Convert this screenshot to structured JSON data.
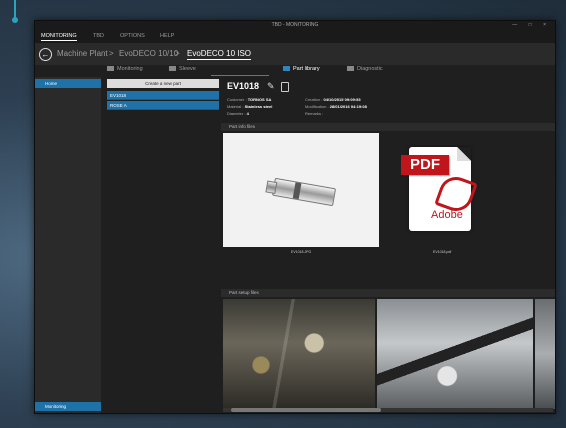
{
  "window": {
    "title": "TBD - MONITORING",
    "controls": "—  □  ×"
  },
  "menu": {
    "items": [
      "MONITORING",
      "TBD",
      "OPTIONS",
      "HELP"
    ]
  },
  "breadcrumb": {
    "back_icon": "back-arrow-icon",
    "items": [
      "Machine Plant",
      "EvoDECO 10/10",
      "EvoDECO 10 ISO"
    ],
    "separator": ">"
  },
  "tabs": [
    {
      "label": "Monitoring",
      "icon": "monitor-icon"
    },
    {
      "label": "Sleeve",
      "icon": "sleeve-icon"
    },
    {
      "label": "Part library",
      "icon": "library-icon",
      "active": true
    },
    {
      "label": "Diagnostic",
      "icon": "diagnostic-icon"
    }
  ],
  "sidebar": {
    "items": [
      "Home"
    ],
    "bottom": "Monitoring"
  },
  "parts": {
    "new_label": "Create a new part",
    "list": [
      "EV1018",
      "ROSE A"
    ]
  },
  "detail": {
    "name": "EV1018",
    "fields_left": [
      {
        "label": "Customer",
        "value": "TORNOS SA"
      },
      {
        "label": "Material",
        "value": "Stainless steel"
      },
      {
        "label": "Diameter",
        "value": "4"
      }
    ],
    "fields_right": [
      {
        "label": "Creation",
        "value": "04/10/2015 09:09:53"
      },
      {
        "label": "Modification",
        "value": "28/01/2016 04:19:08"
      },
      {
        "label": "Remarks",
        "value": ""
      }
    ],
    "info_header": "Part info files",
    "info_files": [
      "EV1018.JPG",
      "EV1018.pdf"
    ],
    "setup_header": "Part setup files",
    "pdf": {
      "banner": "PDF",
      "brand": "Adobe"
    }
  },
  "colors": {
    "accent": "#1e72a8",
    "pdf_red": "#c0161b"
  }
}
